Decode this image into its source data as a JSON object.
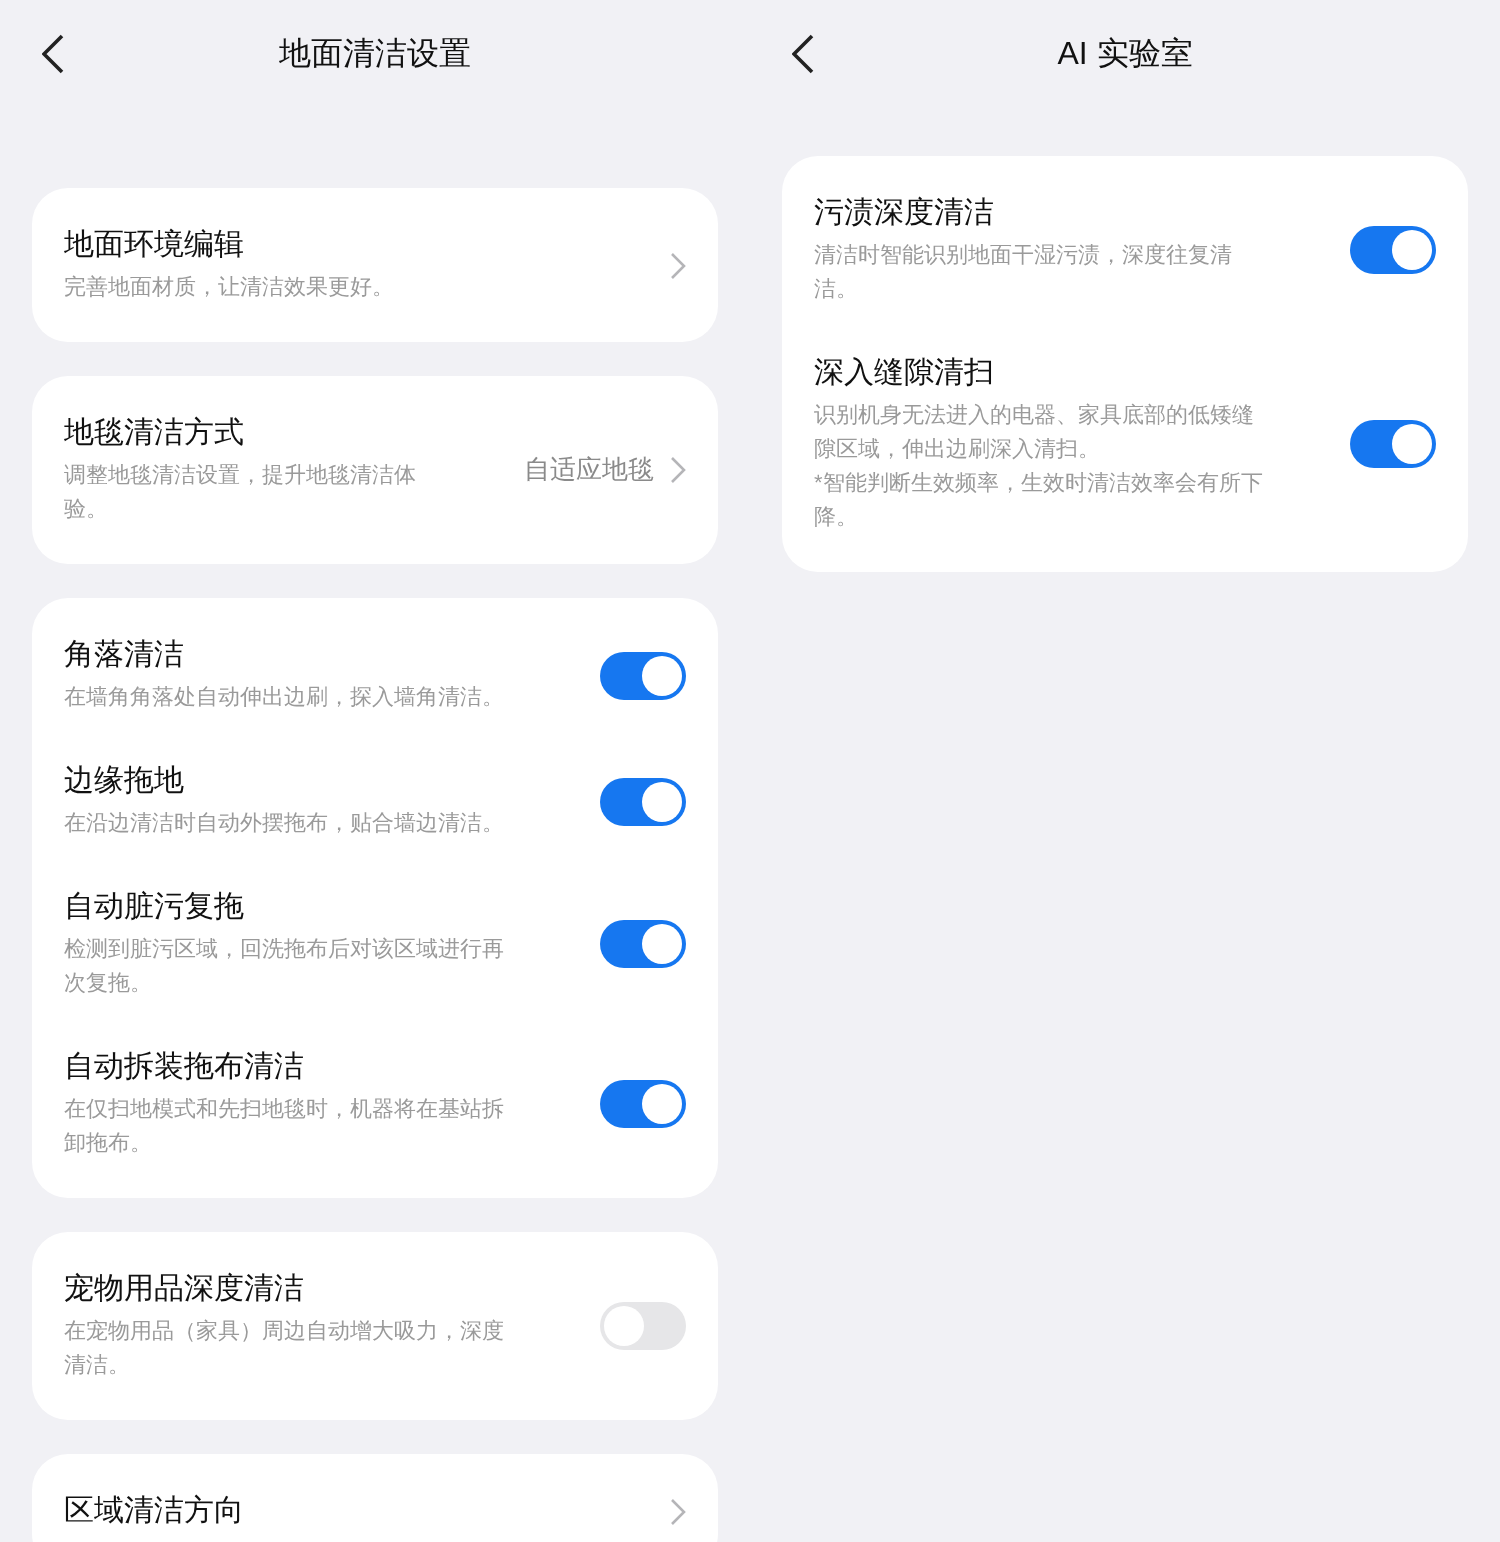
{
  "panels": [
    {
      "title": "地面清洁设置",
      "cards": [
        {
          "items": [
            {
              "kind": "link",
              "title": "地面环境编辑",
              "description": "完善地面材质，让清洁效果更好。"
            }
          ]
        },
        {
          "items": [
            {
              "kind": "link",
              "title": "地毯清洁方式",
              "description": "调整地毯清洁设置，提升地毯清洁体验。",
              "value": "自适应地毯"
            }
          ]
        },
        {
          "items": [
            {
              "kind": "toggle",
              "title": "角落清洁",
              "description": "在墙角角落处自动伸出边刷，探入墙角清洁。",
              "on": true
            },
            {
              "kind": "toggle",
              "title": "边缘拖地",
              "description": "在沿边清洁时自动外摆拖布，贴合墙边清洁。",
              "on": true
            },
            {
              "kind": "toggle",
              "title": "自动脏污复拖",
              "description": "检测到脏污区域，回洗拖布后对该区域进行再次复拖。",
              "on": true
            },
            {
              "kind": "toggle",
              "title": "自动拆装拖布清洁",
              "description": "在仅扫地模式和先扫地毯时，机器将在基站拆卸拖布。",
              "on": true
            }
          ]
        },
        {
          "items": [
            {
              "kind": "toggle",
              "title": "宠物用品深度清洁",
              "description": "在宠物用品（家具）周边自动增大吸力，深度清洁。",
              "on": false
            }
          ]
        },
        {
          "items": [
            {
              "kind": "link",
              "title": "区域清洁方向"
            }
          ]
        }
      ]
    },
    {
      "title": "AI 实验室",
      "cards": [
        {
          "items": [
            {
              "kind": "toggle",
              "title": "污渍深度清洁",
              "description": "清洁时智能识别地面干湿污渍，深度往复清洁。",
              "on": true
            },
            {
              "kind": "toggle",
              "title": "深入缝隙清扫",
              "description": "识别机身无法进入的电器、家具底部的低矮缝隙区域，伸出边刷深入清扫。",
              "note": "*智能判断生效频率，生效时清洁效率会有所下降。",
              "on": true
            }
          ]
        }
      ]
    }
  ]
}
